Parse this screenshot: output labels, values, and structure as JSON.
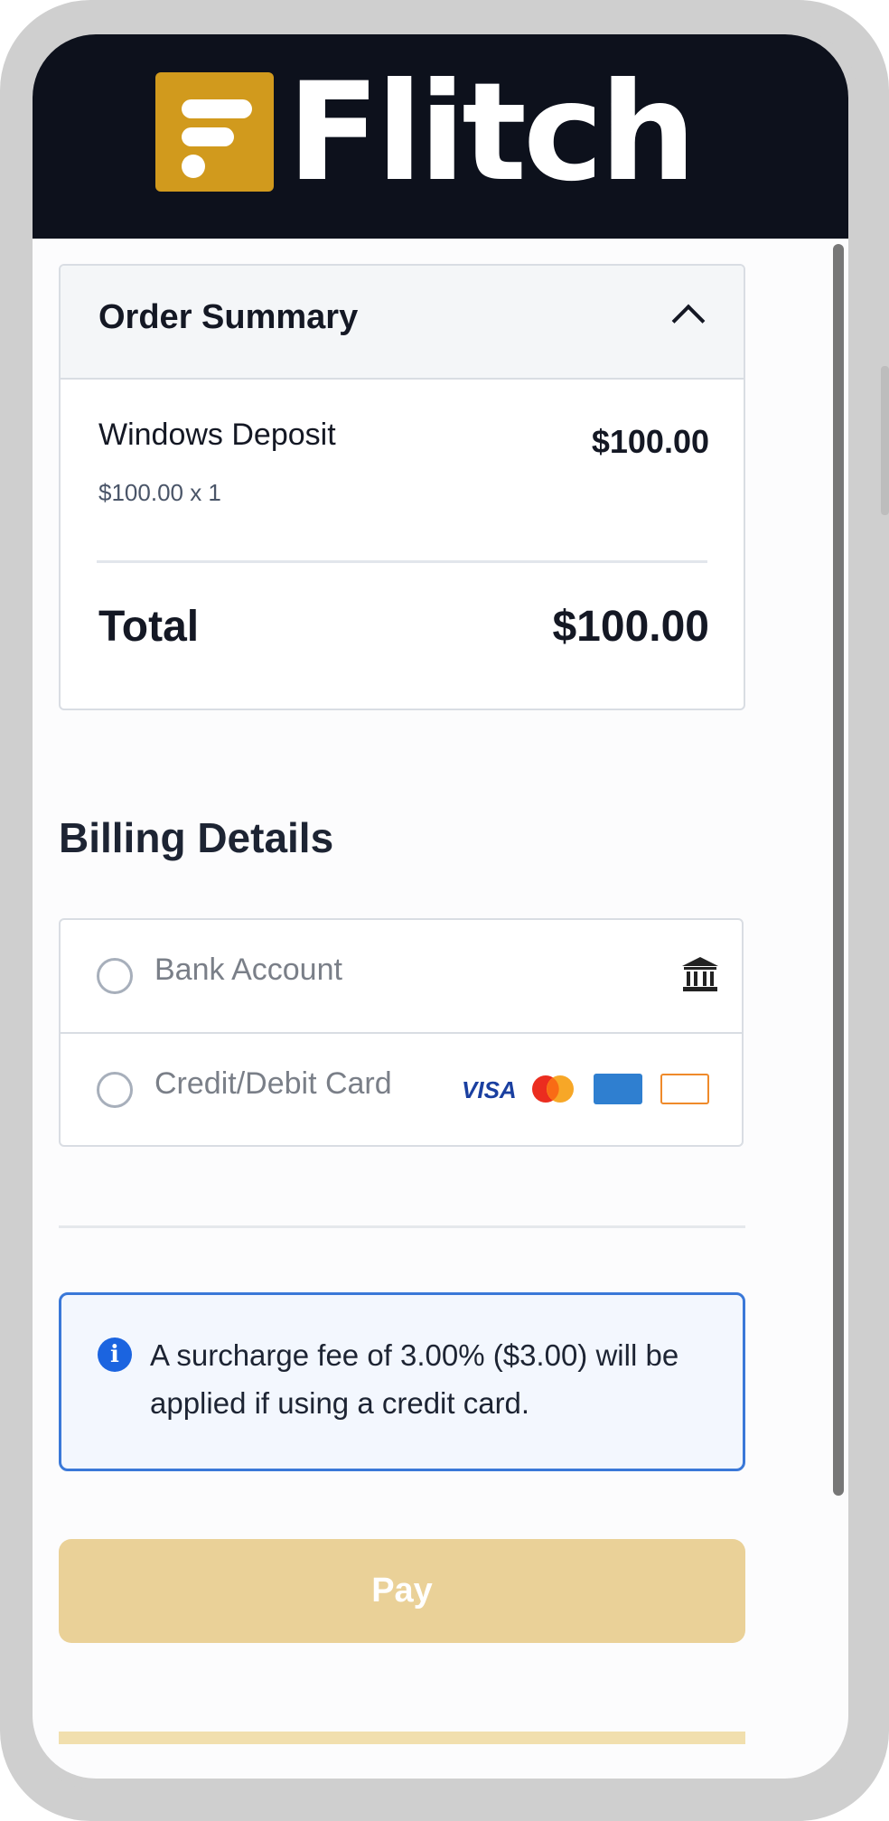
{
  "brand": {
    "name": "Flitch",
    "accent_color": "#d19a1d",
    "header_color": "#0d111c"
  },
  "order_summary": {
    "title": "Order Summary",
    "collapse_icon": "chevron-up-icon",
    "item": {
      "name": "Windows Deposit",
      "price": "$100.00",
      "unit_qty": "$100.00 x 1"
    },
    "total_label": "Total",
    "total_value": "$100.00"
  },
  "billing": {
    "title": "Billing Details",
    "options": [
      {
        "label": "Bank Account",
        "icon": "bank-icon",
        "selected": false
      },
      {
        "label": "Credit/Debit Card",
        "icons": [
          "visa-icon",
          "mastercard-icon",
          "amex-icon",
          "discover-icon"
        ],
        "selected": false
      }
    ],
    "card_brand_text": "VISA"
  },
  "notice": {
    "icon": "info-icon",
    "text": "A surcharge fee of 3.00% ($3.00) will be applied if using a credit card."
  },
  "actions": {
    "pay_label": "Pay",
    "pay_color": "#ead198"
  }
}
